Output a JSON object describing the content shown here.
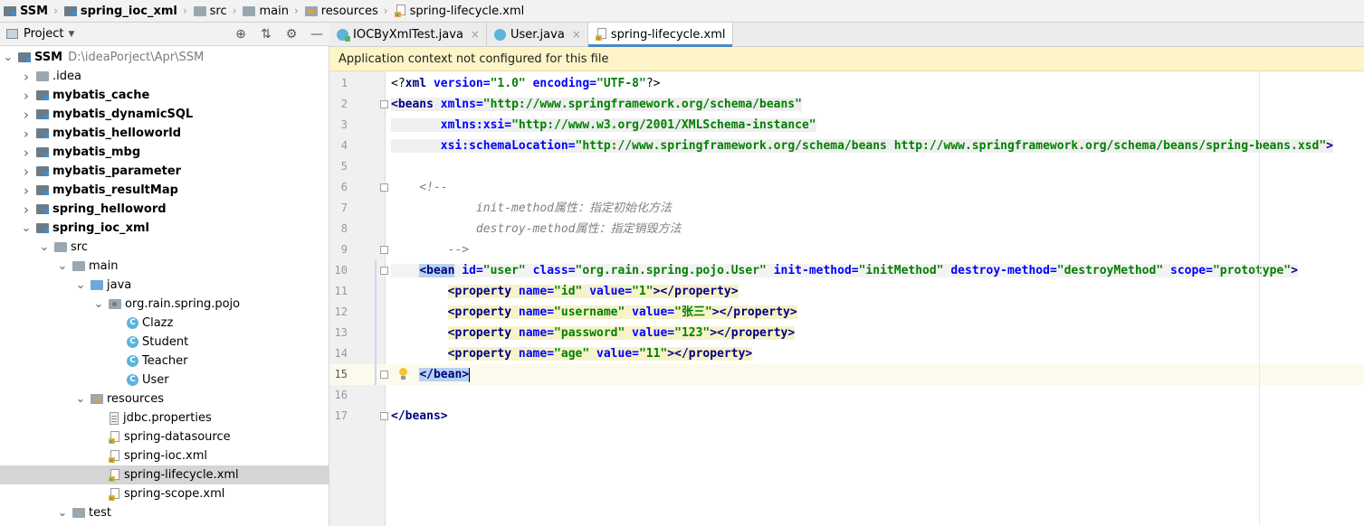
{
  "breadcrumb": [
    "SSM",
    "spring_ioc_xml",
    "src",
    "main",
    "resources",
    "spring-lifecycle.xml"
  ],
  "project_panel": {
    "title": "Project",
    "tools": [
      "globe-icon",
      "collapse-icon",
      "gear-icon",
      "minimize-icon"
    ]
  },
  "tree": [
    {
      "label": "SSM",
      "path": "D:\\ideaPorject\\Apr\\SSM",
      "depth": 0,
      "expanded": true,
      "icon": "module-folder-icon",
      "bold": true
    },
    {
      "label": ".idea",
      "depth": 1,
      "expanded": false,
      "icon": "folder-icon",
      "bold": false
    },
    {
      "label": "mybatis_cache",
      "depth": 1,
      "expanded": false,
      "icon": "module-folder-icon",
      "bold": true
    },
    {
      "label": "mybatis_dynamicSQL",
      "depth": 1,
      "expanded": false,
      "icon": "module-folder-icon",
      "bold": true
    },
    {
      "label": "mybatis_helloworld",
      "depth": 1,
      "expanded": false,
      "icon": "module-folder-icon",
      "bold": true
    },
    {
      "label": "mybatis_mbg",
      "depth": 1,
      "expanded": false,
      "icon": "module-folder-icon",
      "bold": true
    },
    {
      "label": "mybatis_parameter",
      "depth": 1,
      "expanded": false,
      "icon": "module-folder-icon",
      "bold": true
    },
    {
      "label": "mybatis_resultMap",
      "depth": 1,
      "expanded": false,
      "icon": "module-folder-icon",
      "bold": true
    },
    {
      "label": "spring_helloword",
      "depth": 1,
      "expanded": false,
      "icon": "module-folder-icon",
      "bold": true
    },
    {
      "label": "spring_ioc_xml",
      "depth": 1,
      "expanded": true,
      "icon": "module-folder-icon",
      "bold": true
    },
    {
      "label": "src",
      "depth": 2,
      "expanded": true,
      "icon": "folder-icon",
      "bold": false
    },
    {
      "label": "main",
      "depth": 3,
      "expanded": true,
      "icon": "folder-icon",
      "bold": false
    },
    {
      "label": "java",
      "depth": 4,
      "expanded": true,
      "icon": "source-folder-icon",
      "bold": false
    },
    {
      "label": "org.rain.spring.pojo",
      "depth": 5,
      "expanded": true,
      "icon": "package-icon",
      "bold": false
    },
    {
      "label": "Clazz",
      "depth": 6,
      "icon": "class-icon",
      "bold": false
    },
    {
      "label": "Student",
      "depth": 6,
      "icon": "class-icon",
      "bold": false
    },
    {
      "label": "Teacher",
      "depth": 6,
      "icon": "class-icon",
      "bold": false
    },
    {
      "label": "User",
      "depth": 6,
      "icon": "class-icon",
      "bold": false
    },
    {
      "label": "resources",
      "depth": 4,
      "expanded": true,
      "icon": "resources-folder-icon",
      "bold": false
    },
    {
      "label": "jdbc.properties",
      "depth": 5,
      "icon": "properties-file-icon",
      "bold": false
    },
    {
      "label": "spring-datasource",
      "depth": 5,
      "icon": "spring-xml-icon",
      "bold": false
    },
    {
      "label": "spring-ioc.xml",
      "depth": 5,
      "icon": "spring-xml-icon",
      "bold": false
    },
    {
      "label": "spring-lifecycle.xml",
      "depth": 5,
      "icon": "spring-xml-icon",
      "bold": false,
      "selected": true
    },
    {
      "label": "spring-scope.xml",
      "depth": 5,
      "icon": "spring-xml-icon",
      "bold": false
    },
    {
      "label": "test",
      "depth": 3,
      "expanded": true,
      "icon": "folder-icon",
      "bold": false
    }
  ],
  "tabs": [
    {
      "label": "IOCByXmlTest.java",
      "icon": "test-class-icon",
      "active": false
    },
    {
      "label": "User.java",
      "icon": "class-icon",
      "active": false
    },
    {
      "label": "spring-lifecycle.xml",
      "icon": "spring-xml-icon",
      "active": true
    }
  ],
  "banner": {
    "text": "Application context not configured for this file"
  },
  "editor": {
    "current_line": 15,
    "lines": [
      {
        "n": "1",
        "text": "<?xml version=\"1.0\" encoding=\"UTF-8\"?>"
      },
      {
        "n": "2",
        "text": "<beans xmlns=\"http://www.springframework.org/schema/beans\""
      },
      {
        "n": "3",
        "text": "       xmlns:xsi=\"http://www.w3.org/2001/XMLSchema-instance\""
      },
      {
        "n": "4",
        "text": "       xsi:schemaLocation=\"http://www.springframework.org/schema/beans http://www.springframework.org/schema/beans/spring-beans.xsd\">"
      },
      {
        "n": "5",
        "text": ""
      },
      {
        "n": "6",
        "text": "    <!--"
      },
      {
        "n": "7",
        "text": "            init-method属性：指定初始化方法"
      },
      {
        "n": "8",
        "text": "            destroy-method属性：指定销毁方法"
      },
      {
        "n": "9",
        "text": "        -->"
      },
      {
        "n": "10",
        "text": "    <bean id=\"user\" class=\"org.rain.spring.pojo.User\" init-method=\"initMethod\" destroy-method=\"destroyMethod\" scope=\"prototype\">"
      },
      {
        "n": "11",
        "text": "        <property name=\"id\" value=\"1\"></property>"
      },
      {
        "n": "12",
        "text": "        <property name=\"username\" value=\"张三\"></property>"
      },
      {
        "n": "13",
        "text": "        <property name=\"password\" value=\"123\"></property>"
      },
      {
        "n": "14",
        "text": "        <property name=\"age\" value=\"11\"></property>"
      },
      {
        "n": "15",
        "text": "    </bean>"
      },
      {
        "n": "16",
        "text": ""
      },
      {
        "n": "17",
        "text": "</beans>"
      }
    ]
  },
  "colors": {
    "tag": "#000080",
    "attribute": "#0000ff",
    "value": "#008000",
    "comment": "#808080",
    "banner_bg": "#fdf5c8",
    "selection": "#d5d5d5"
  }
}
